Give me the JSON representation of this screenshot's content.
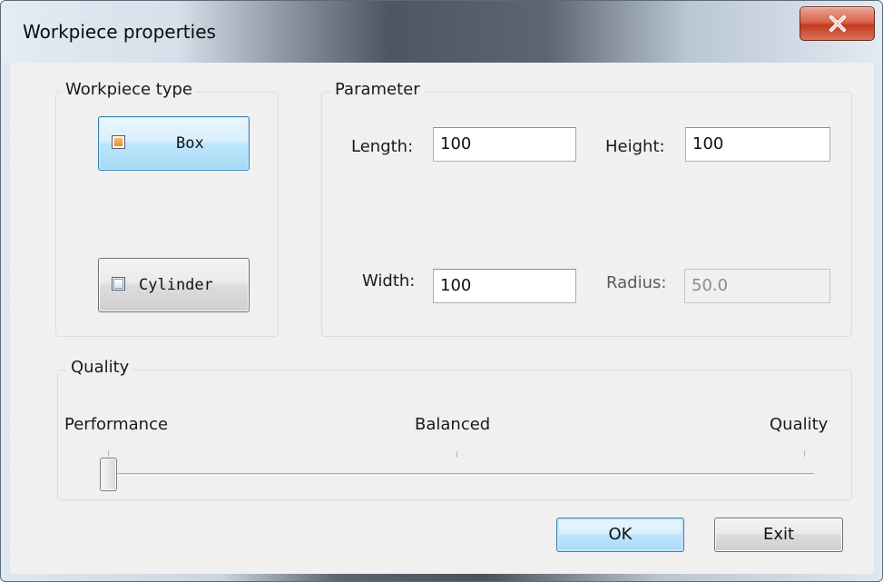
{
  "window": {
    "title": "Workpiece properties",
    "close_icon": "close-x-icon"
  },
  "workpiece_type": {
    "label": "Workpiece type",
    "options": [
      {
        "label": "Box",
        "selected": true
      },
      {
        "label": "Cylinder",
        "selected": false
      }
    ]
  },
  "parameter": {
    "label": "Parameter",
    "length": {
      "label": "Length:",
      "value": "100"
    },
    "height": {
      "label": "Height:",
      "value": "100"
    },
    "width": {
      "label": "Width:",
      "value": "100"
    },
    "radius": {
      "label": "Radius:",
      "value": "50.0",
      "enabled": false
    }
  },
  "quality": {
    "label": "Quality",
    "levels": [
      "Performance",
      "Balanced",
      "Quality"
    ],
    "selected_index": 0
  },
  "buttons": {
    "ok_label": "OK",
    "exit_label": "Exit"
  },
  "colors": {
    "accent_border": "#3c7fb1",
    "close_red": "#c4391f",
    "dialog_bg": "#f0f0f0"
  }
}
